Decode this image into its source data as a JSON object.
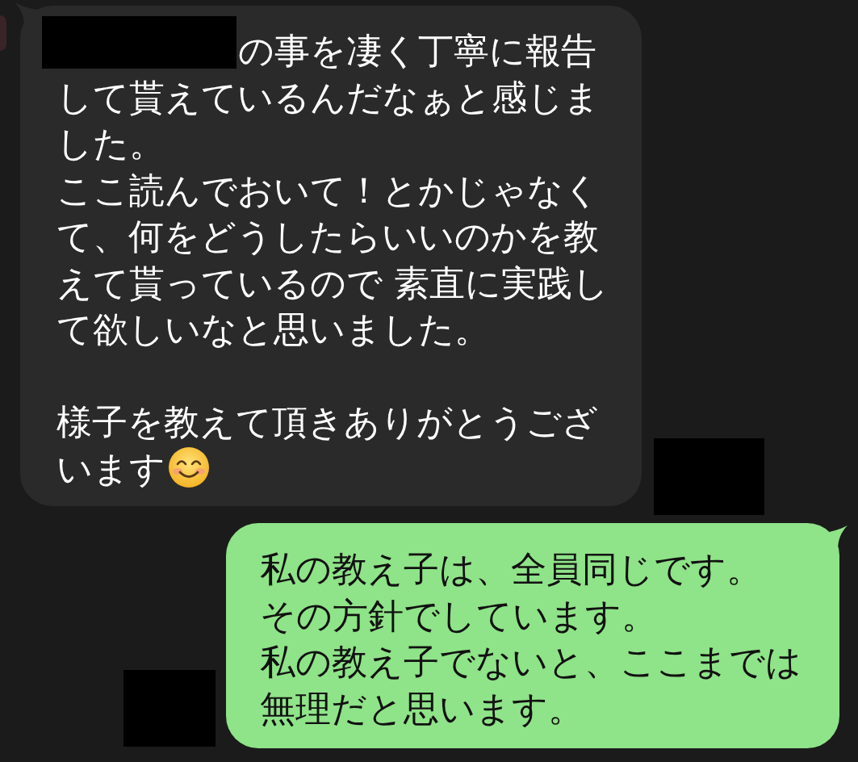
{
  "chat": {
    "messages": [
      {
        "kind": "incoming",
        "name_redacted": true,
        "paragraphs": [
          {
            "lines": [
              "の事を凄く丁寧に報告",
              "して貰えているんだなぁと感じました。",
              "ここ読んでおいて！とかじゃなくて、何をどうしたらいいのかを教えて貰っているので 素直に実践して欲しいなと思いました。"
            ]
          },
          {
            "lines": [
              "様子を教えて頂きありがとうござ",
              "います"
            ]
          }
        ],
        "emoji": true,
        "time_redacted": true
      },
      {
        "kind": "outgoing",
        "paragraphs": [
          {
            "lines": [
              "私の教え子は、全員同じです。",
              "その方針でしています。",
              "私の教え子でないと、ここまでは無理だと思います。"
            ]
          }
        ],
        "time_redacted": true
      }
    ]
  }
}
